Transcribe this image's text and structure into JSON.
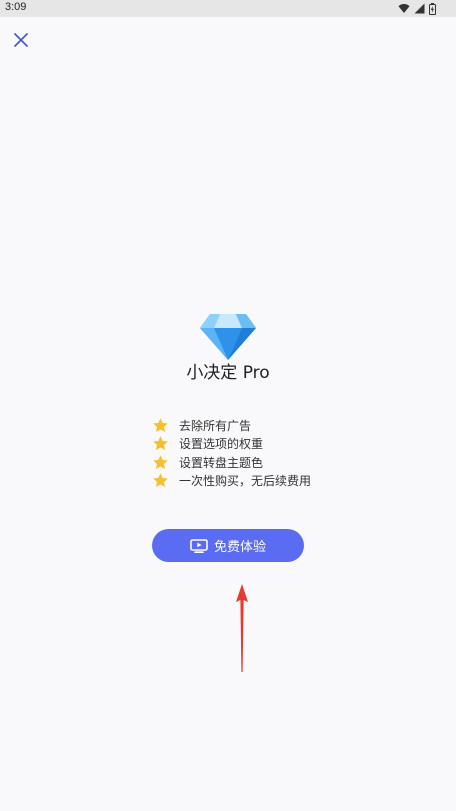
{
  "status_bar": {
    "time": "3:09"
  },
  "product": {
    "title": "小决定 Pro"
  },
  "features": [
    {
      "text": "去除所有广告"
    },
    {
      "text": "设置选项的权重"
    },
    {
      "text": "设置转盘主题色"
    },
    {
      "text": "一次性购买，无后续费用"
    }
  ],
  "trial_button": {
    "label": "免费体验"
  },
  "colors": {
    "accent": "#5a6cf2",
    "star": "#f6c02c",
    "arrow": "#e8382f",
    "diamond": "#3ba4f5",
    "close_icon": "#4a5bd6"
  }
}
